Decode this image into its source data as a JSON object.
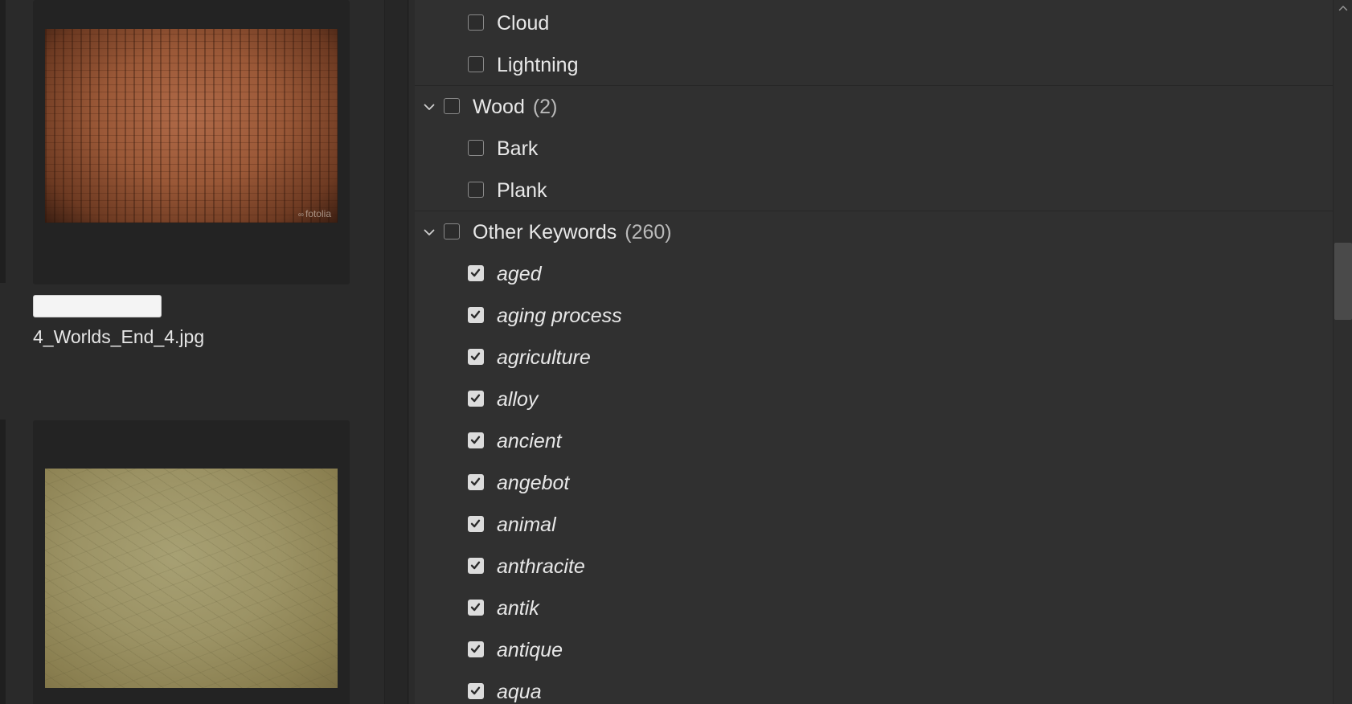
{
  "content_pane": {
    "file_name": "4_Worlds_End_4.jpg",
    "rename_field_value": "",
    "thumbnails": [
      {
        "name": "bark-texture-thumbnail",
        "watermark": "fotolia"
      },
      {
        "name": "leather-texture-thumbnail",
        "watermark": ""
      }
    ]
  },
  "keywords": {
    "top_children": [
      {
        "label": "Cloud",
        "checked": false
      },
      {
        "label": "Lightning",
        "checked": false
      }
    ],
    "groups": [
      {
        "label": "Wood",
        "count": "(2)",
        "expanded": true,
        "checked": false,
        "children": [
          {
            "label": "Bark",
            "checked": false
          },
          {
            "label": "Plank",
            "checked": false
          }
        ]
      },
      {
        "label": "Other Keywords",
        "count": "(260)",
        "expanded": true,
        "checked": false,
        "children_italic": true,
        "children": [
          {
            "label": "aged",
            "checked": true
          },
          {
            "label": "aging process",
            "checked": true
          },
          {
            "label": "agriculture",
            "checked": true
          },
          {
            "label": "alloy",
            "checked": true
          },
          {
            "label": "ancient",
            "checked": true
          },
          {
            "label": "angebot",
            "checked": true
          },
          {
            "label": "animal",
            "checked": true
          },
          {
            "label": "anthracite",
            "checked": true
          },
          {
            "label": "antik",
            "checked": true
          },
          {
            "label": "antique",
            "checked": true
          },
          {
            "label": "aqua",
            "checked": true
          }
        ]
      }
    ]
  },
  "icons": {
    "chevron": "chevron-down-icon",
    "check": "checkmark-icon",
    "scroll_up": "chevron-up-icon"
  },
  "colors": {
    "panel_bg": "#303030",
    "sidebar_bg": "#2a2a2a",
    "text": "#e8e8e8",
    "count_text": "#b9b9b9"
  }
}
